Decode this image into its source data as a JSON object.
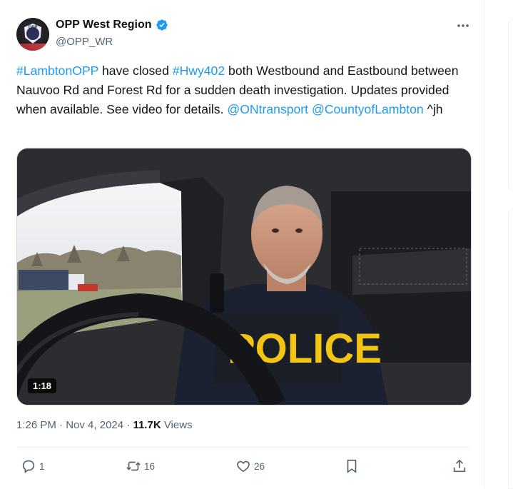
{
  "account": {
    "name": "OPP West Region",
    "handle": "@OPP_WR",
    "avatar_text": "OPP"
  },
  "tweet": {
    "segments": [
      {
        "text": "#LambtonOPP",
        "link": true
      },
      {
        "text": " have closed ",
        "link": false
      },
      {
        "text": "#Hwy402",
        "link": true
      },
      {
        "text": " both Westbound and Eastbound between Nauvoo Rd and Forest Rd for a sudden death investigation. Updates provided when available. See video for details. ",
        "link": false
      },
      {
        "text": "@ONtransport",
        "link": true
      },
      {
        "text": " ",
        "link": false
      },
      {
        "text": "@CountyofLambton",
        "link": true
      },
      {
        "text": " ^jh",
        "link": false
      }
    ]
  },
  "media": {
    "duration": "1:18",
    "vest_text": "POLICE"
  },
  "meta": {
    "time": "1:26 PM",
    "separator": "·",
    "date": "Nov 4, 2024",
    "views_count": "11.7K",
    "views_label": "Views"
  },
  "actions": {
    "reply_count": "1",
    "repost_count": "16",
    "like_count": "26"
  },
  "colors": {
    "link": "#1d9bf0",
    "secondary_text": "#536471",
    "verified": "#1d9bf0"
  },
  "icons": [
    "verified-badge-icon",
    "more-icon",
    "reply-icon",
    "repost-icon",
    "like-icon",
    "bookmark-icon",
    "share-icon"
  ]
}
